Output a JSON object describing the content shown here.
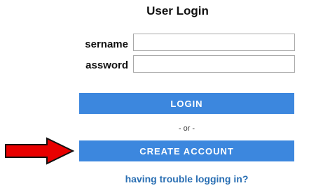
{
  "login_form": {
    "title": "User Login",
    "username_label": "sername",
    "username_value": "",
    "password_label": "assword",
    "password_value": "",
    "login_button": "LOGIN",
    "separator": "- or -",
    "create_account_button": "CREATE ACCOUNT",
    "trouble_link": "having trouble logging in?"
  },
  "colors": {
    "button_bg": "#3c87de",
    "link": "#2a6fb3",
    "arrow_fill": "#e80000"
  }
}
